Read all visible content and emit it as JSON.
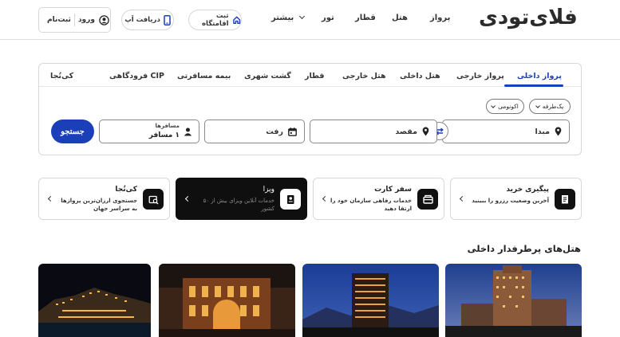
{
  "header": {
    "logo": "فلای‌تودی",
    "nav": {
      "flight": "پرواز",
      "hotel": "هتل",
      "train": "قطار",
      "tour": "تور",
      "more": "بیشتر"
    },
    "register_residence": "ثبت اقامتگاه",
    "get_app": "دریافت اَپ",
    "login": "ورود",
    "signup": "ثبت‌نام"
  },
  "search": {
    "tabs": [
      "پرواز داخلی",
      "پرواز خارجی",
      "هتل داخلی",
      "هتل خارجی",
      "قطار",
      "گشت شهری",
      "بیمه مسافرتی",
      "CIP فرودگاهی",
      "کی‌تُجا"
    ],
    "active_tab": "پرواز داخلی",
    "trip_type": "یک‌طرفه",
    "cabin_class": "اکونومی",
    "origin": "مبدا",
    "destination": "مقصد",
    "depart": "رفت",
    "passengers_label": "مسافرها",
    "passengers_value": "۱ مسافر",
    "submit": "جستجو"
  },
  "cards": [
    {
      "title": "پیگیری خرید",
      "desc": "آخرین وضعیت رزرو را ببینید",
      "icon": "receipt-icon"
    },
    {
      "title": "سفر کارت",
      "desc": "خدمات رفاهی سازمان خود را ارتقا دهید",
      "icon": "wallet-icon"
    },
    {
      "title": "ویزا",
      "desc": "خدمات آنلاین ویزای بیش از ۵۰ کشور",
      "icon": "passport-icon"
    },
    {
      "title": "کی‌تُجا",
      "desc": "جستجوی ارزان‌ترین پروازها به سراسر جهان",
      "icon": "ticket-search-icon"
    }
  ],
  "hotels": {
    "title": "هتل‌های پرطرفدار داخلی"
  },
  "colors": {
    "accent": "#1a3fb8",
    "dark_card": "#0f0f0f"
  }
}
